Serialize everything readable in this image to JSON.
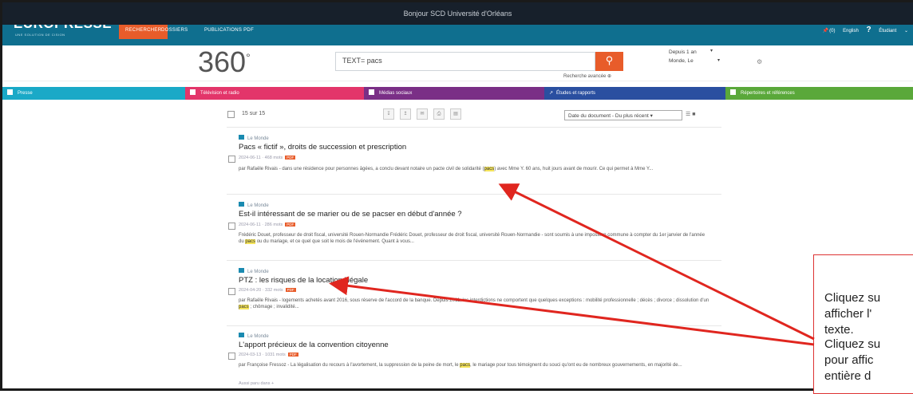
{
  "topbar": {
    "greeting": "Bonjour SCD Université d'Orléans"
  },
  "nav": {
    "logo": "EUROPRESSE",
    "logo_sub": "UNE SOLUTION DE CISION",
    "tabs": [
      "RECHERCHER",
      "DOSSIERS",
      "PUBLICATIONS PDF"
    ],
    "right": {
      "pins": "(0)",
      "lang": "English",
      "help": "?",
      "user": "Étudiant"
    }
  },
  "search": {
    "logo": "360",
    "query": "TEXT= pacs",
    "advanced": "Recherche avancée",
    "period": "Depuis 1 an",
    "source": "Monde, Le"
  },
  "categories": [
    {
      "label": "Presse",
      "color": "#1aa9c7"
    },
    {
      "label": "Télévision et radio",
      "color": "#e3356a"
    },
    {
      "label": "Médias sociaux",
      "color": "#7a2f86"
    },
    {
      "label": "Études et rapports",
      "color": "#2a4fa0"
    },
    {
      "label": "Répertoires et références",
      "color": "#5aa83a"
    }
  ],
  "toolbar": {
    "count": "15 sur 15",
    "sort": "Date du document - Du plus récent"
  },
  "results": [
    {
      "source": "Le Monde",
      "title": "Pacs « fictif », droits de succession et prescription",
      "meta": "2024-06-11 · 468 mots",
      "snippet_before": "par Rafaële Rivais - dans une résidence pour personnes âgées, a conclu devant notaire un pacte civil de solidarité (",
      "snippet_hl": "pacs",
      "snippet_after": ") avec Mme Y. 60 ans, huit jours avant de mourir. Ce qui permet à Mme Y..."
    },
    {
      "source": "Le Monde",
      "title": "Est-il intéressant de se marier ou de se pacser en début d'année ?",
      "meta": "2024-06-11 · 286 mots",
      "snippet_before": "Frédéric Douet, professeur de droit fiscal, université Rouen-Normandie Frédéric Douet, professeur de droit fiscal, université Rouen-Normandie - sont soumis à une imposition commune à compter du 1er janvier de l'année du ",
      "snippet_hl": "pacs",
      "snippet_after": " ou du mariage, et ce quel que soit le mois de l'événement. Quant à vous..."
    },
    {
      "source": "Le Monde",
      "title": "PTZ : les risques de la location illégale",
      "meta": "2024-04-20 · 332 mots",
      "snippet_before": "par Rafaële Rivais - logements achetés avant 2016, sous réserve de l'accord de la banque. Depuis 2011, les interdictions ne comportent que quelques exceptions : mobilité professionnelle ; décès ; divorce ; dissolution d'un ",
      "snippet_hl": "pacs",
      "snippet_after": " ; chômage ; invalidité..."
    },
    {
      "source": "Le Monde",
      "title": "L'apport précieux de la convention citoyenne",
      "meta": "2024-03-13 · 1031 mots",
      "snippet_before": "par Françoise Fressoz - La légalisation du recours à l'avortement, la suppression de la peine de mort, le ",
      "snippet_hl": "pacs",
      "snippet_after": ", le mariage pour tous témoignent du souci qu'ont eu de nombreux gouvernements, en majorité de...",
      "extra": "Aussi paru dans +"
    }
  ],
  "callout": {
    "lines": [
      "Cliquez su",
      "afficher l'",
      "texte.",
      "Cliquez su",
      "pour affic",
      "entière d"
    ]
  },
  "colors": {
    "accent": "#e85c2a",
    "nav": "#0f6f8f",
    "arrow": "#e0261f"
  }
}
